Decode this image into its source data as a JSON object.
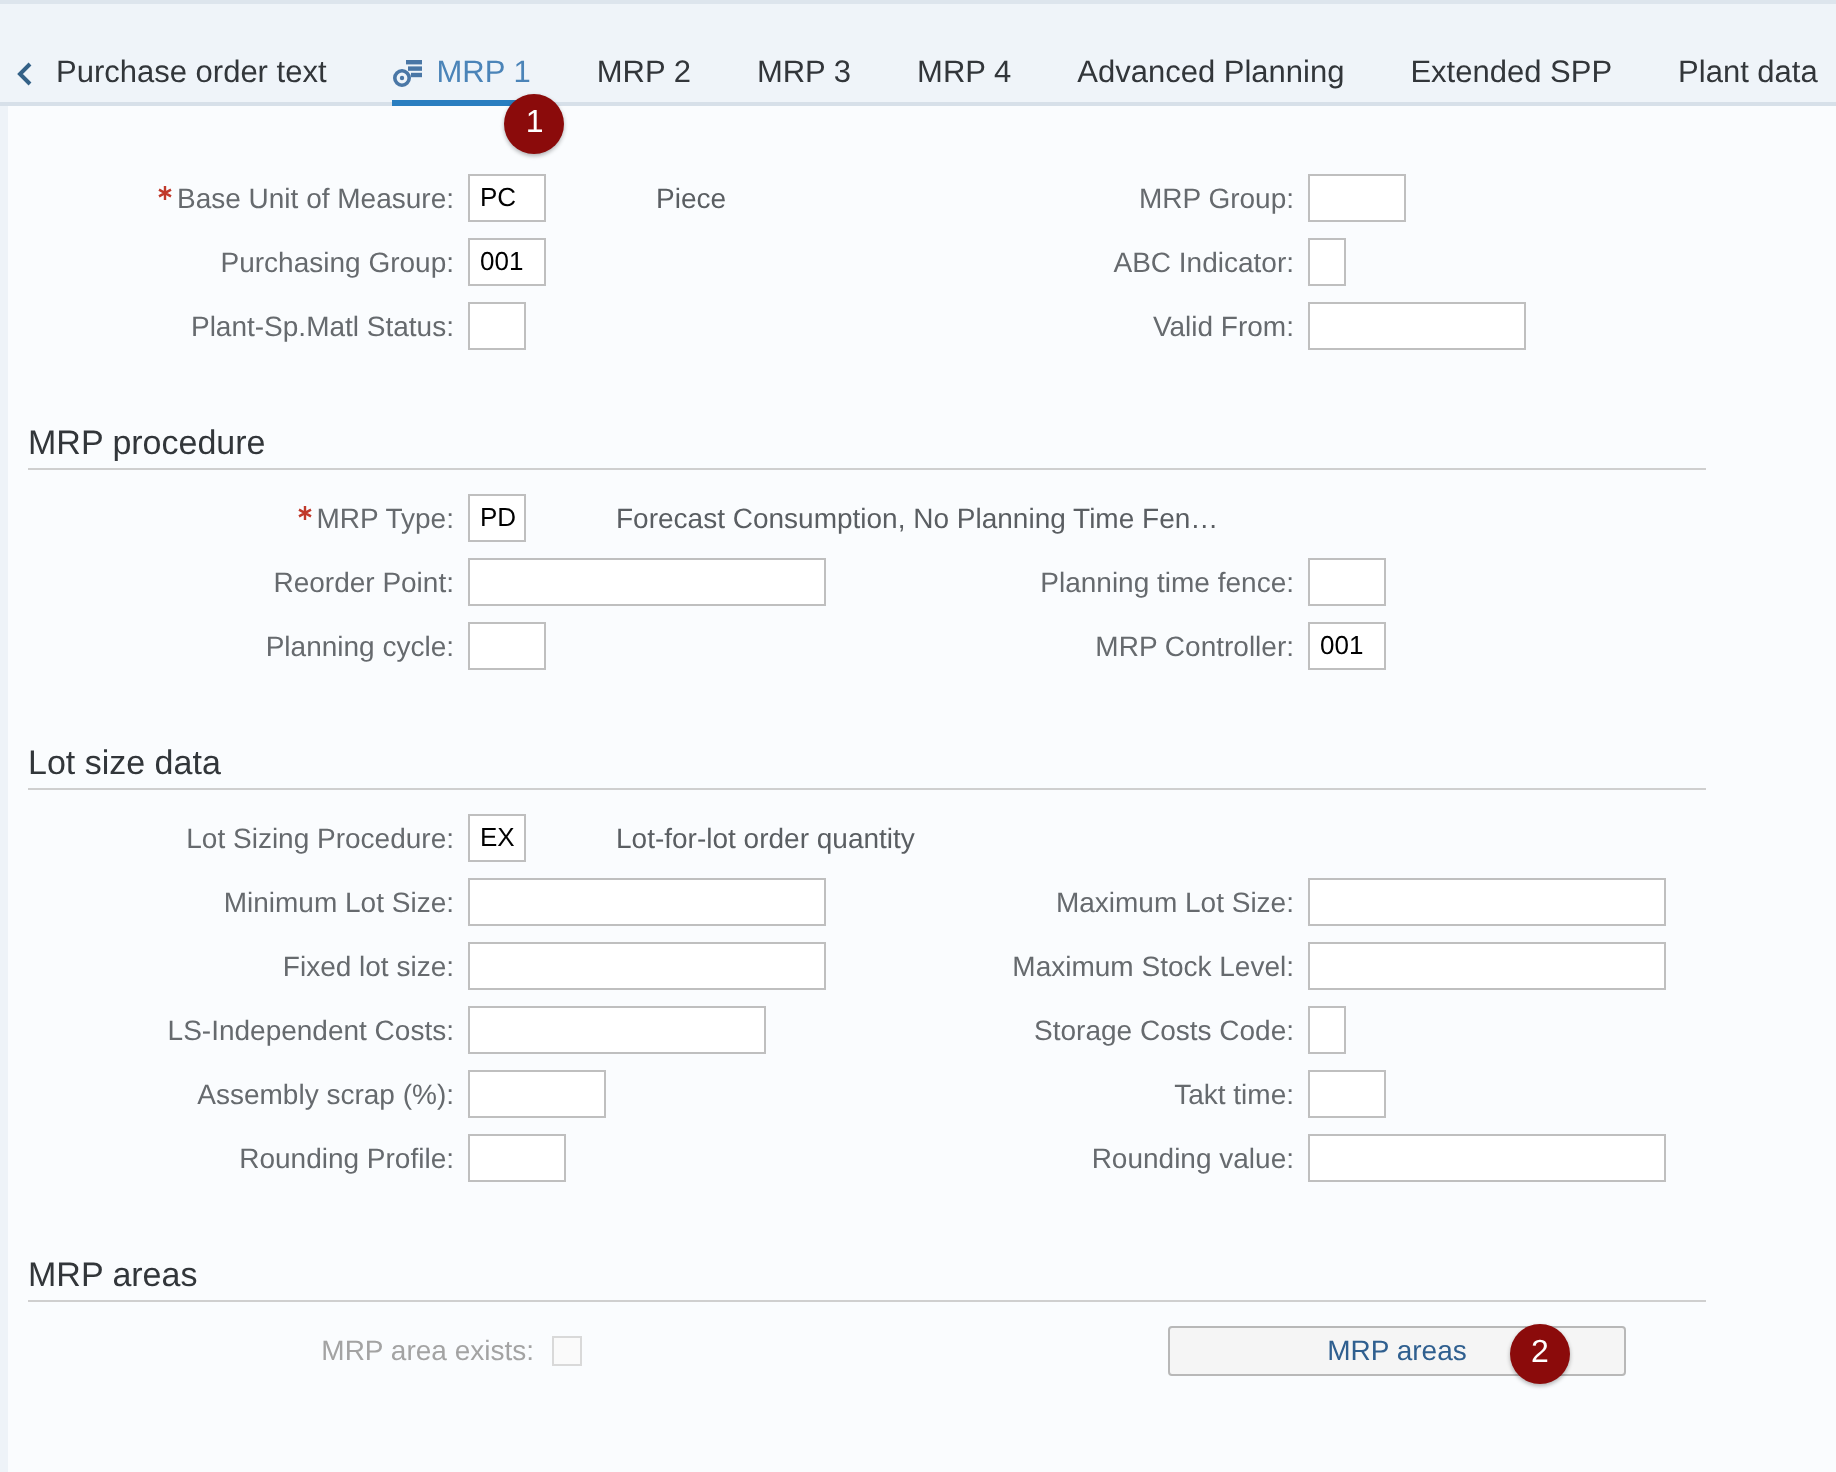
{
  "tabs": {
    "items": [
      {
        "label": "Purchase order text",
        "selected": false,
        "has_icon": false
      },
      {
        "label": "MRP 1",
        "selected": true,
        "has_icon": true,
        "step": "1"
      },
      {
        "label": "MRP 2",
        "selected": false,
        "has_icon": false
      },
      {
        "label": "MRP 3",
        "selected": false,
        "has_icon": false
      },
      {
        "label": "MRP 4",
        "selected": false,
        "has_icon": false
      },
      {
        "label": "Advanced Planning",
        "selected": false,
        "has_icon": false
      },
      {
        "label": "Extended SPP",
        "selected": false,
        "has_icon": false
      },
      {
        "label": "Plant data",
        "selected": false,
        "has_icon": false
      }
    ]
  },
  "sections": [
    {
      "rows": [
        {
          "left": {
            "kind": "input",
            "label": "Base Unit of Measure:",
            "required": true,
            "value": "PC",
            "description": "Piece"
          },
          "right": {
            "kind": "input",
            "label": "MRP Group:",
            "required": false
          }
        },
        {
          "left": {
            "kind": "input",
            "label": "Purchasing Group:",
            "required": false,
            "value": "001"
          },
          "right": {
            "kind": "input",
            "label": "ABC Indicator:",
            "required": false
          }
        },
        {
          "left": {
            "kind": "input",
            "label": "Plant-Sp.Matl Status:",
            "required": false
          },
          "right": {
            "kind": "input",
            "label": "Valid From:",
            "required": false
          }
        }
      ]
    },
    {
      "heading": "MRP procedure",
      "rows": [
        {
          "left": {
            "kind": "input",
            "label": "MRP Type:",
            "required": true,
            "value": "PD",
            "description": "Forecast Consumption, No Planning Time Fen…"
          }
        },
        {
          "left": {
            "kind": "input",
            "label": "Reorder Point:",
            "required": false
          },
          "right": {
            "kind": "input",
            "label": "Planning time fence:",
            "required": false
          }
        },
        {
          "left": {
            "kind": "input",
            "label": "Planning cycle:",
            "required": false
          },
          "right": {
            "kind": "input",
            "label": "MRP Controller:",
            "required": false,
            "value": "001"
          }
        }
      ]
    },
    {
      "heading": "Lot size data",
      "rows": [
        {
          "left": {
            "kind": "input",
            "label": "Lot Sizing Procedure:",
            "required": false,
            "value": "EX",
            "description": "Lot-for-lot order quantity"
          }
        },
        {
          "left": {
            "kind": "input",
            "label": "Minimum Lot Size:",
            "required": false
          },
          "right": {
            "kind": "input",
            "label": "Maximum Lot Size:",
            "required": false
          }
        },
        {
          "left": {
            "kind": "input",
            "label": "Fixed lot size:",
            "required": false
          },
          "right": {
            "kind": "input",
            "label": "Maximum Stock Level:",
            "required": false
          }
        },
        {
          "left": {
            "kind": "input",
            "label": "LS-Independent Costs:",
            "required": false
          },
          "right": {
            "kind": "input",
            "label": "Storage Costs Code:",
            "required": false
          }
        },
        {
          "left": {
            "kind": "input",
            "label": "Assembly scrap (%):",
            "required": false
          },
          "right": {
            "kind": "input",
            "label": "Takt time:",
            "required": false
          }
        },
        {
          "left": {
            "kind": "input",
            "label": "Rounding Profile:",
            "required": false
          },
          "right": {
            "kind": "input",
            "label": "Rounding value:",
            "required": false
          }
        }
      ]
    },
    {
      "heading": "MRP areas",
      "rows": [
        {
          "left": {
            "kind": "checkbox",
            "label": "MRP area exists:",
            "checked": false,
            "disabled": true
          },
          "right": {
            "kind": "button",
            "label": "MRP areas",
            "step": "2"
          }
        }
      ]
    }
  ]
}
